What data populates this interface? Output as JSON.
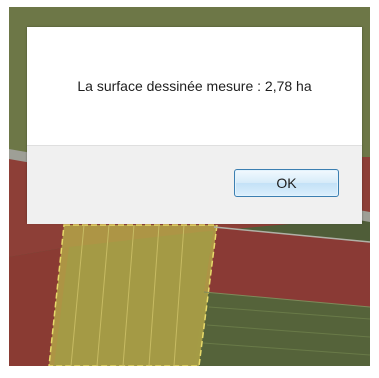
{
  "dialog": {
    "message": "La surface dessinée mesure : 2,78 ha",
    "ok_label": "OK"
  },
  "map": {
    "background_imagery": "aerial-fields",
    "colors": {
      "red_field": "#8b3a35",
      "yellow_highlight": "#b5a94a",
      "green_field": "#4f5d38",
      "road": "#a9a9a0"
    }
  }
}
